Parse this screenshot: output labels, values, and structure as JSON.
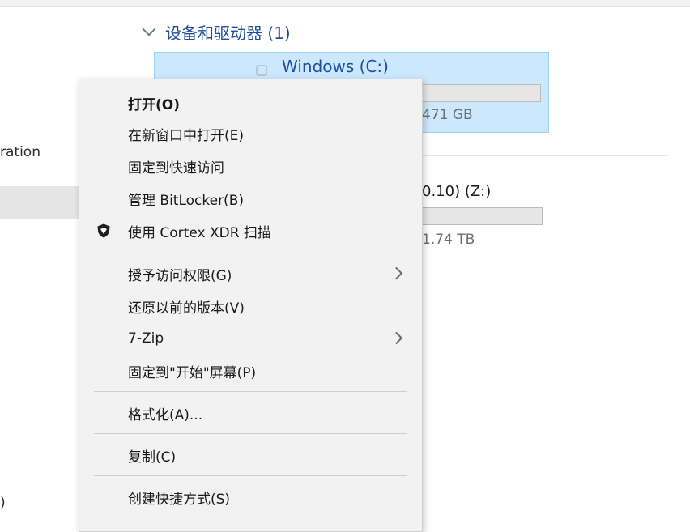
{
  "navigation": {
    "partial_item_text": "ration",
    "bottom_partial_text": ")"
  },
  "devices_group": {
    "header": "设备和驱动器 (1)"
  },
  "drives": [
    {
      "name": "Windows (C:)",
      "size_text": "471 GB",
      "selected": true
    },
    {
      "name_partial": "0.10) (Z:)",
      "size_text": "1.74 TB",
      "selected": false
    }
  ],
  "context_menu": {
    "items": [
      {
        "label": "打开(O)",
        "bold": true,
        "icon": null,
        "submenu": false
      },
      {
        "label": "在新窗口中打开(E)",
        "bold": false,
        "icon": null,
        "submenu": false
      },
      {
        "label": "固定到快速访问",
        "bold": false,
        "icon": null,
        "submenu": false
      },
      {
        "label": "管理 BitLocker(B)",
        "bold": false,
        "icon": null,
        "submenu": false
      },
      {
        "label": "使用 Cortex XDR 扫描",
        "bold": false,
        "icon": "cortex-xdr-shield-icon",
        "submenu": false
      },
      {
        "label": "授予访问权限(G)",
        "bold": false,
        "icon": null,
        "submenu": true
      },
      {
        "label": "还原以前的版本(V)",
        "bold": false,
        "icon": null,
        "submenu": false
      },
      {
        "label": "7-Zip",
        "bold": false,
        "icon": null,
        "submenu": true
      },
      {
        "label": "固定到\"开始\"屏幕(P)",
        "bold": false,
        "icon": null,
        "submenu": false
      },
      {
        "label": "格式化(A)...",
        "bold": false,
        "icon": null,
        "submenu": false
      },
      {
        "label": "复制(C)",
        "bold": false,
        "icon": null,
        "submenu": false
      },
      {
        "label": "创建快捷方式(S)",
        "bold": false,
        "icon": null,
        "submenu": false
      }
    ]
  },
  "colors": {
    "selection_fill": "#cce8ff",
    "selection_border": "#99d1ff",
    "header_blue": "#1e4e9c",
    "menu_background": "#f2f2f2"
  }
}
